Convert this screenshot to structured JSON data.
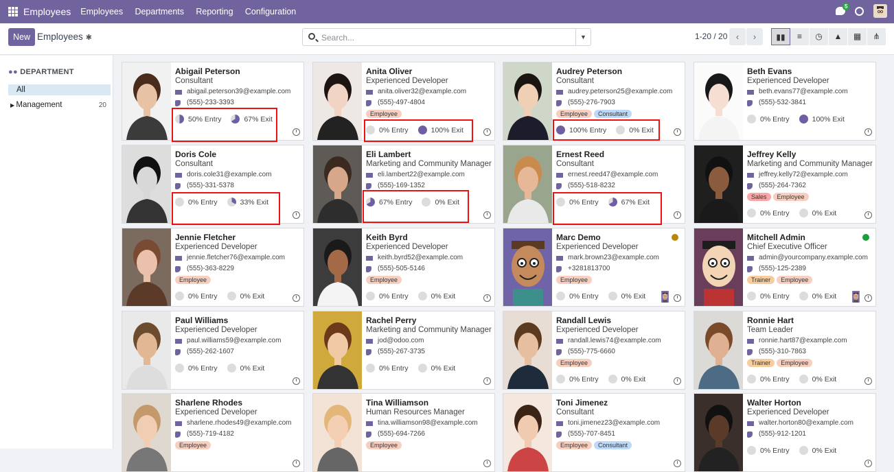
{
  "app": {
    "title": "Employees",
    "menu": [
      "Employees",
      "Departments",
      "Reporting",
      "Configuration"
    ],
    "chat_badge": "5"
  },
  "control": {
    "new_label": "New",
    "breadcrumb": "Employees",
    "search_placeholder": "Search...",
    "pager": "1-20 / 20"
  },
  "sidebar": {
    "header": "DEPARTMENT",
    "items": [
      {
        "label": "All"
      },
      {
        "label": "Management",
        "count": "20"
      }
    ]
  },
  "employees": [
    {
      "name": "Abigail Peterson",
      "job": "Consultant",
      "email": "abigail.peterson39@example.com",
      "phone": "(555)-233-3393",
      "tags": [],
      "entry": "50% Entry",
      "exit": "67% Exit",
      "entry_pct": 50,
      "exit_pct": 67
    },
    {
      "name": "Anita Oliver",
      "job": "Experienced Developer",
      "email": "anita.oliver32@example.com",
      "phone": "(555)-497-4804",
      "tags": [
        "Employee"
      ],
      "entry": "0% Entry",
      "exit": "100% Exit",
      "entry_pct": 0,
      "exit_pct": 100
    },
    {
      "name": "Audrey Peterson",
      "job": "Consultant",
      "email": "audrey.peterson25@example.com",
      "phone": "(555)-276-7903",
      "tags": [
        "Employee",
        "Consultant"
      ],
      "entry": "100% Entry",
      "exit": "0% Exit",
      "entry_pct": 100,
      "exit_pct": 0
    },
    {
      "name": "Beth Evans",
      "job": "Experienced Developer",
      "email": "beth.evans77@example.com",
      "phone": "(555)-532-3841",
      "tags": [],
      "entry": "0% Entry",
      "exit": "100% Exit",
      "entry_pct": 0,
      "exit_pct": 100
    },
    {
      "name": "Doris Cole",
      "job": "Consultant",
      "email": "doris.cole31@example.com",
      "phone": "(555)-331-5378",
      "tags": [],
      "entry": "0% Entry",
      "exit": "33% Exit",
      "entry_pct": 0,
      "exit_pct": 33
    },
    {
      "name": "Eli Lambert",
      "job": "Marketing and Community Manager",
      "email": "eli.lambert22@example.com",
      "phone": "(555)-169-1352",
      "tags": [],
      "entry": "67% Entry",
      "exit": "0% Exit",
      "entry_pct": 67,
      "exit_pct": 0
    },
    {
      "name": "Ernest Reed",
      "job": "Consultant",
      "email": "ernest.reed47@example.com",
      "phone": "(555)-518-8232",
      "tags": [],
      "entry": "0% Entry",
      "exit": "67% Exit",
      "entry_pct": 0,
      "exit_pct": 67
    },
    {
      "name": "Jeffrey Kelly",
      "job": "Marketing and Community Manager",
      "email": "jeffrey.kelly72@example.com",
      "phone": "(555)-264-7362",
      "tags": [
        "Sales",
        "Employee"
      ],
      "entry": "0% Entry",
      "exit": "0% Exit",
      "entry_pct": 0,
      "exit_pct": 0
    },
    {
      "name": "Jennie Fletcher",
      "job": "Experienced Developer",
      "email": "jennie.fletcher76@example.com",
      "phone": "(555)-363-8229",
      "tags": [
        "Employee"
      ],
      "entry": "0% Entry",
      "exit": "0% Exit",
      "entry_pct": 0,
      "exit_pct": 0
    },
    {
      "name": "Keith Byrd",
      "job": "Experienced Developer",
      "email": "keith.byrd52@example.com",
      "phone": "(555)-505-5146",
      "tags": [
        "Employee"
      ],
      "entry": "0% Entry",
      "exit": "0% Exit",
      "entry_pct": 0,
      "exit_pct": 0
    },
    {
      "name": "Marc Demo",
      "job": "Experienced Developer",
      "email": "mark.brown23@example.com",
      "phone": "+3281813700",
      "tags": [
        "Employee"
      ],
      "entry": "0% Entry",
      "exit": "0% Exit",
      "entry_pct": 0,
      "exit_pct": 0,
      "status_color": "#b8860b",
      "manager_avatar": true
    },
    {
      "name": "Mitchell Admin",
      "job": "Chief Executive Officer",
      "email": "admin@yourcompany.example.com",
      "phone": "(555)-125-2389",
      "tags": [
        "Trainer",
        "Employee"
      ],
      "entry": "0% Entry",
      "exit": "0% Exit",
      "entry_pct": 0,
      "exit_pct": 0,
      "status_color": "#1a9e3a",
      "manager_avatar": true
    },
    {
      "name": "Paul Williams",
      "job": "Experienced Developer",
      "email": "paul.williams59@example.com",
      "phone": "(555)-262-1607",
      "tags": [],
      "entry": "0% Entry",
      "exit": "0% Exit",
      "entry_pct": 0,
      "exit_pct": 0
    },
    {
      "name": "Rachel Perry",
      "job": "Marketing and Community Manager",
      "email": "jod@odoo.com",
      "phone": "(555)-267-3735",
      "tags": [],
      "entry": "0% Entry",
      "exit": "0% Exit",
      "entry_pct": 0,
      "exit_pct": 0
    },
    {
      "name": "Randall Lewis",
      "job": "Experienced Developer",
      "email": "randall.lewis74@example.com",
      "phone": "(555)-775-6660",
      "tags": [
        "Employee"
      ],
      "entry": "0% Entry",
      "exit": "0% Exit",
      "entry_pct": 0,
      "exit_pct": 0
    },
    {
      "name": "Ronnie Hart",
      "job": "Team Leader",
      "email": "ronnie.hart87@example.com",
      "phone": "(555)-310-7863",
      "tags": [
        "Trainer",
        "Employee"
      ],
      "entry": "0% Entry",
      "exit": "0% Exit",
      "entry_pct": 0,
      "exit_pct": 0
    },
    {
      "name": "Sharlene Rhodes",
      "job": "Experienced Developer",
      "email": "sharlene.rhodes49@example.com",
      "phone": "(555)-719-4182",
      "tags": [
        "Employee"
      ],
      "entry": "",
      "exit": "",
      "entry_pct": 0,
      "exit_pct": 0
    },
    {
      "name": "Tina Williamson",
      "job": "Human Resources Manager",
      "email": "tina.williamson98@example.com",
      "phone": "(555)-694-7266",
      "tags": [
        "Employee"
      ],
      "entry": "",
      "exit": "",
      "entry_pct": 0,
      "exit_pct": 0
    },
    {
      "name": "Toni Jimenez",
      "job": "Consultant",
      "email": "toni.jimenez23@example.com",
      "phone": "(555)-707-8451",
      "tags": [
        "Employee",
        "Consultant"
      ],
      "entry": "",
      "exit": "",
      "entry_pct": 0,
      "exit_pct": 0
    },
    {
      "name": "Walter Horton",
      "job": "Experienced Developer",
      "email": "walter.horton80@example.com",
      "phone": "(555)-912-1201",
      "tags": [],
      "entry": "0% Entry",
      "exit": "0% Exit",
      "entry_pct": 0,
      "exit_pct": 0
    }
  ],
  "colors": {
    "brand": "#71639e",
    "pie_fill": "#6f5ea3",
    "pie_empty": "#dcdcdc",
    "highlight": "#ee1111"
  }
}
